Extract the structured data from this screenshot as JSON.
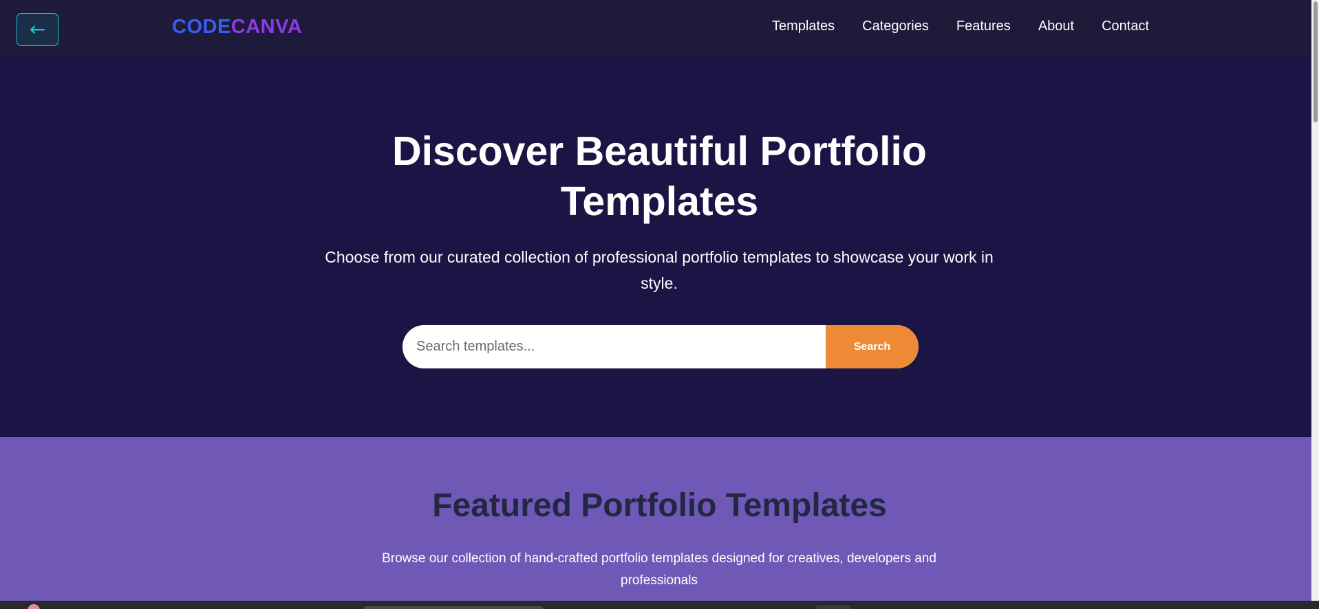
{
  "header": {
    "back_icon": "←",
    "logo_part_a": "CODE",
    "logo_part_b": "CANVA",
    "nav": [
      "Templates",
      "Categories",
      "Features",
      "About",
      "Contact"
    ]
  },
  "hero": {
    "title_line_1": "Discover Beautiful Portfolio",
    "title_line_2": "Templates",
    "subtitle": "Choose from our curated collection of professional portfolio templates to showcase your work in style.",
    "search": {
      "placeholder": "Search templates...",
      "value": "",
      "button_label": "Search"
    }
  },
  "featured": {
    "title": "Featured Portfolio Templates",
    "description": "Browse our collection of hand-crafted portfolio templates designed for creatives, developers and professionals"
  },
  "colors": {
    "header_bg": "#1d1a3a",
    "hero_bg": "#1b1545",
    "featured_bg": "#7058b6",
    "accent_orange": "#ee8a36",
    "logo_blue": "#3b5df0",
    "logo_purple": "#8f3ae8",
    "back_button_cyan": "#22c3d6"
  }
}
